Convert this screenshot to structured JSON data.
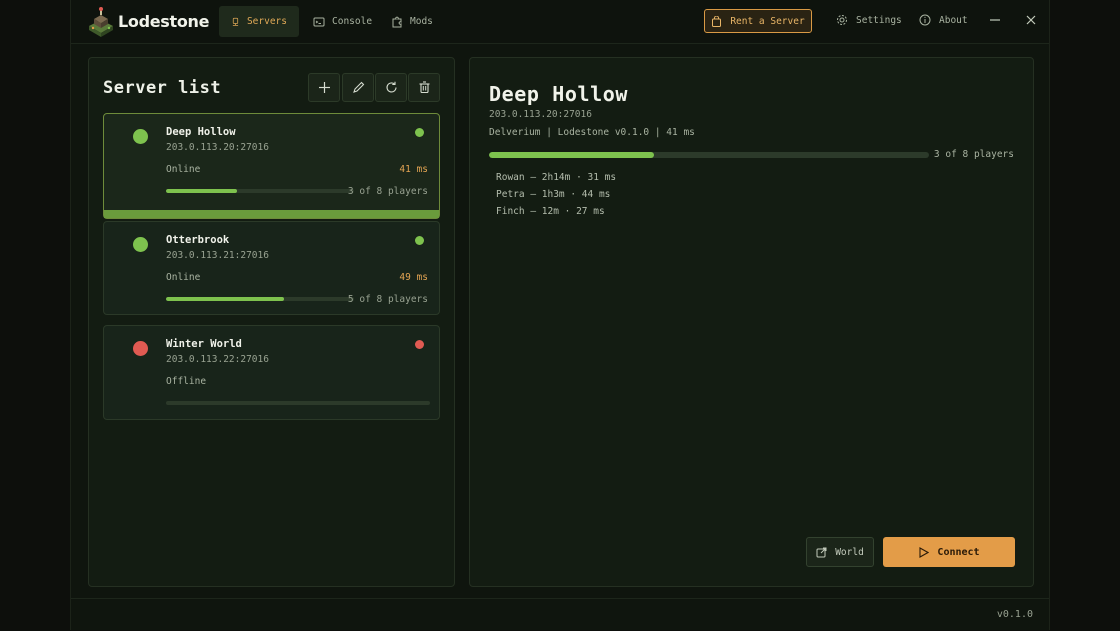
{
  "app": {
    "name": "Lodestone",
    "version": "v0.1.0"
  },
  "nav": {
    "tabs": [
      {
        "label": "Servers",
        "icon": "server-icon",
        "active": true
      },
      {
        "label": "Console",
        "icon": "terminal-icon",
        "active": false
      },
      {
        "label": "Mods",
        "icon": "puzzle-icon",
        "active": false
      }
    ],
    "rent_label": "Rent a Server",
    "settings_label": "Settings",
    "about_label": "About"
  },
  "server_list": {
    "title": "Server list",
    "tools": [
      "plus-icon",
      "pencil-icon",
      "refresh-icon",
      "trash-icon"
    ],
    "servers": [
      {
        "name": "Deep Hollow",
        "address": "203.0.113.20:27016",
        "status": "Online",
        "ping": "41 ms",
        "players": "3 of 8 players",
        "player_fraction": 0.375,
        "online": true,
        "selected": true
      },
      {
        "name": "Otterbrook",
        "address": "203.0.113.21:27016",
        "status": "Online",
        "ping": "49 ms",
        "players": "5 of 8 players",
        "player_fraction": 0.625,
        "online": true,
        "selected": false
      },
      {
        "name": "Winter World",
        "address": "203.0.113.22:27016",
        "status": "Offline",
        "ping": "",
        "players": "",
        "player_fraction": 0,
        "online": false,
        "selected": false
      }
    ]
  },
  "detail": {
    "title": "Deep Hollow",
    "address": "203.0.113.20:27016",
    "meta": "Delverium | Lodestone v0.1.0 | 41 ms",
    "players": "3 of 8 players",
    "player_fraction": 0.375,
    "player_list": [
      "Rowan — 2h14m · 31 ms",
      "Petra — 1h3m · 44 ms",
      "Finch — 12m · 27 ms"
    ],
    "world_label": "World",
    "connect_label": "Connect"
  },
  "colors": {
    "accent": "#e39c48",
    "online": "#7ec24e",
    "offline": "#e05a52",
    "selected_bar": "#6a9b3c"
  }
}
